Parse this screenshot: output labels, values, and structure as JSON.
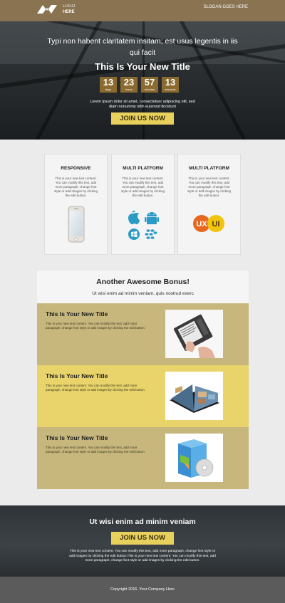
{
  "header": {
    "logo_top": "LOGO",
    "logo_bottom": "HERE",
    "slogan": "SLOGAN GOES HERE"
  },
  "hero": {
    "subtitle": "Typi non habent claritatem insitam; est usus legentis in iis qui facit",
    "title": "This Is Your New Title",
    "countdown": [
      {
        "value": "13",
        "label": "days"
      },
      {
        "value": "23",
        "label": "hours"
      },
      {
        "value": "57",
        "label": "minutes"
      },
      {
        "value": "13",
        "label": "seconds"
      }
    ],
    "description": "Lorem ipsum dolor sit amet, consectetuer adipiscing elit, sed diam nonummy nibh euismod tincidunt",
    "button": "JOIN US NOW"
  },
  "features": [
    {
      "title": "RESPONSIVE",
      "text": "This is your new text content. You can modify this text, add more paragraph, change font style or add images by clicking the edit button.",
      "icon": "smartphone-icon"
    },
    {
      "title": "MULTI PLATFORM",
      "text": "This is your new text content. You can modify this text, add more paragraph, change font style or add images by clicking the edit button.",
      "icon": "platforms-icon"
    },
    {
      "title": "MULTI PLATFORM",
      "text": "This is your new text content. You can modify this text, add more paragraph, change font style or add images by clicking the edit button.",
      "icon": "ux-ui-icon"
    }
  ],
  "platform_badges": {
    "ux": "UX",
    "ui": "UI"
  },
  "bonus": {
    "title": "Another Awesome Bonus!",
    "subtitle": "Ut wisi enim ad minim veniam, quis nostrud exerc",
    "rows": [
      {
        "title": "This Is Your New Title",
        "text": "This is your new text content. You can modify this text, add more paragraph, change font style or add images by clicking the edit button.",
        "image": "ebook-reader-image",
        "bg": "#c7b77d"
      },
      {
        "title": "This Is Your New Title",
        "text": "This is your new text content. You can modify this text, add more paragraph, change font style or add images by clicking the edit button.",
        "image": "photo-album-image",
        "bg": "#e8d46a"
      },
      {
        "title": "This Is Your New Title",
        "text": "This is your new text content. You can modify this text, add more paragraph, change font style or add images by clicking the edit button.",
        "image": "software-box-image",
        "bg": "#c7b77d"
      }
    ]
  },
  "cta": {
    "title": "Ut wisi enim ad minim veniam",
    "button": "JOIN US NOW",
    "text": "This is your new text content. You can modify this text, add more paragraph, change font style or add images by clicking the edit button.This is your new text content. You can modify this text, add more paragraph, change font style or add images by clicking the edit button."
  },
  "footer": {
    "text": "Copyright 2016. Your Company Here"
  },
  "colors": {
    "header_bg": "#8a7351",
    "countdown_bg": "#8a6a2f",
    "button_bg": "#e8d05c",
    "row_tan": "#c7b77d",
    "row_yellow": "#e8d46a",
    "footer_bg": "#5b5b5b"
  }
}
